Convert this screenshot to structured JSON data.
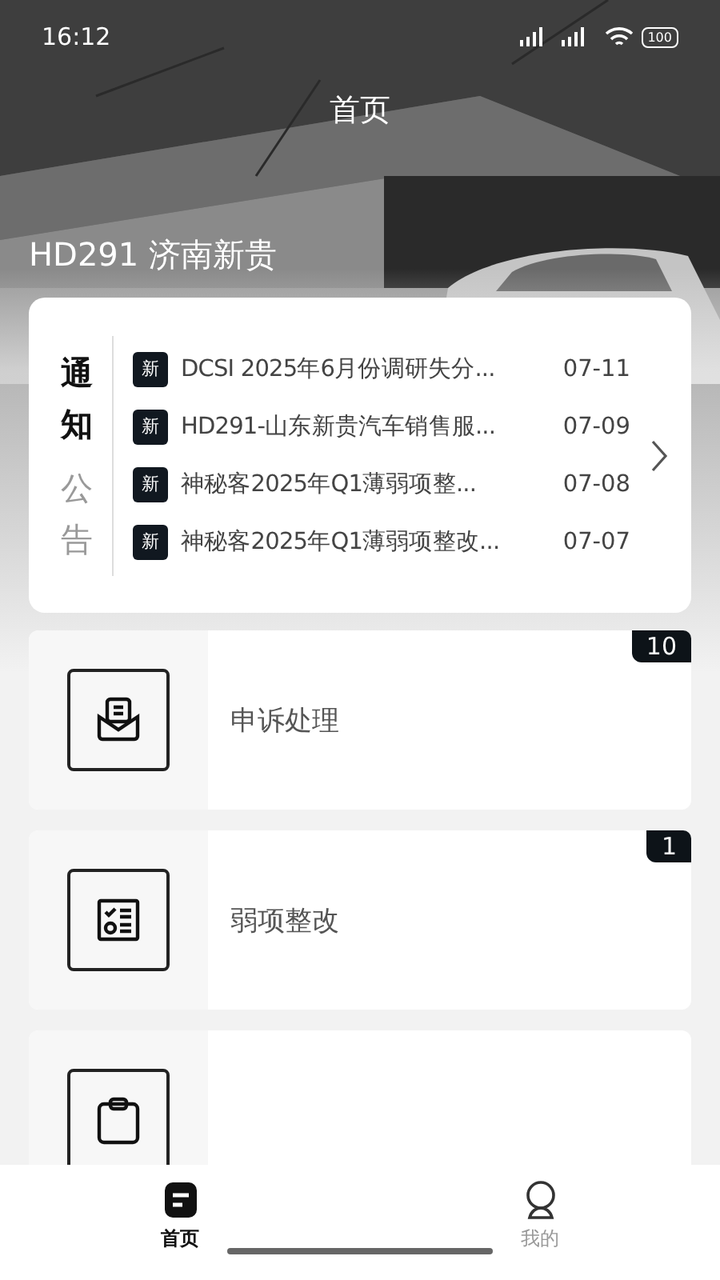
{
  "status_bar": {
    "time": "16:12",
    "battery": "100"
  },
  "header": {
    "title": "首页",
    "dealer": "HD291 济南新贵"
  },
  "notices": {
    "title_dark": "通知",
    "title_light": "公告",
    "items": [
      {
        "badge": "新",
        "text": "DCSI 2025年6月份调研失分...",
        "date": "07-11"
      },
      {
        "badge": "新",
        "text": "HD291-山东新贵汽车销售服...",
        "date": "07-09"
      },
      {
        "badge": "新",
        "text": "神秘客2025年Q1薄弱项整...",
        "date": "07-08"
      },
      {
        "badge": "新",
        "text": "神秘客2025年Q1薄弱项整改...",
        "date": "07-07"
      }
    ]
  },
  "modules": [
    {
      "kind": "complaint",
      "title": "申诉处理",
      "count": "10"
    },
    {
      "kind": "checklist",
      "title": "弱项整改",
      "count": "1"
    },
    {
      "kind": "report"
    }
  ],
  "tab_bar": [
    {
      "kind": "home",
      "label": "首页",
      "selected": true
    },
    {
      "kind": "profile",
      "label": "我的",
      "selected": false
    }
  ]
}
